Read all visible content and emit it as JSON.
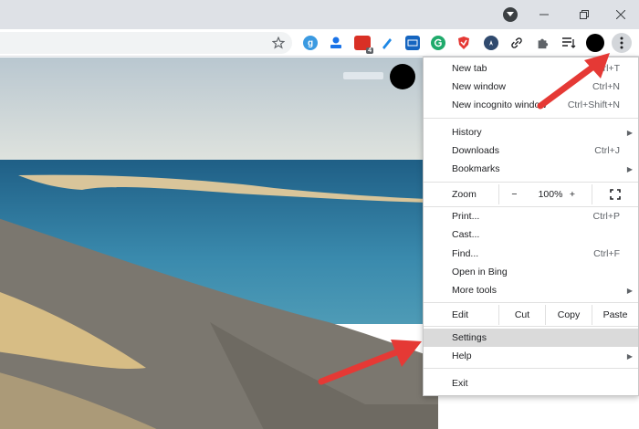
{
  "window": {
    "minimize_icon": "minimize-icon",
    "restore_icon": "restore-icon",
    "close_icon": "close-icon"
  },
  "toolbar": {
    "bookmark_icon": "star-icon",
    "extension_badge": "4",
    "ext_g_label": "g",
    "menu_icon": "three-dots-icon"
  },
  "menu": {
    "new_tab": {
      "label": "New tab",
      "shortcut": "Ctrl+T"
    },
    "new_window": {
      "label": "New window",
      "shortcut": "Ctrl+N"
    },
    "new_incognito": {
      "label": "New incognito window",
      "shortcut": "Ctrl+Shift+N"
    },
    "history": {
      "label": "History"
    },
    "downloads": {
      "label": "Downloads",
      "shortcut": "Ctrl+J"
    },
    "bookmarks": {
      "label": "Bookmarks"
    },
    "zoom": {
      "label": "Zoom",
      "minus": "−",
      "value": "100%",
      "plus": "+"
    },
    "print": {
      "label": "Print...",
      "shortcut": "Ctrl+P"
    },
    "cast": {
      "label": "Cast..."
    },
    "find": {
      "label": "Find...",
      "shortcut": "Ctrl+F"
    },
    "open_in_bing": {
      "label": "Open in Bing"
    },
    "more_tools": {
      "label": "More tools"
    },
    "edit": {
      "label": "Edit",
      "cut": "Cut",
      "copy": "Copy",
      "paste": "Paste"
    },
    "settings": {
      "label": "Settings"
    },
    "help": {
      "label": "Help"
    },
    "exit": {
      "label": "Exit"
    }
  },
  "colors": {
    "annotation_arrow": "#e53935",
    "menu_highlight": "#dadada",
    "titlebar": "#dee1e6"
  }
}
